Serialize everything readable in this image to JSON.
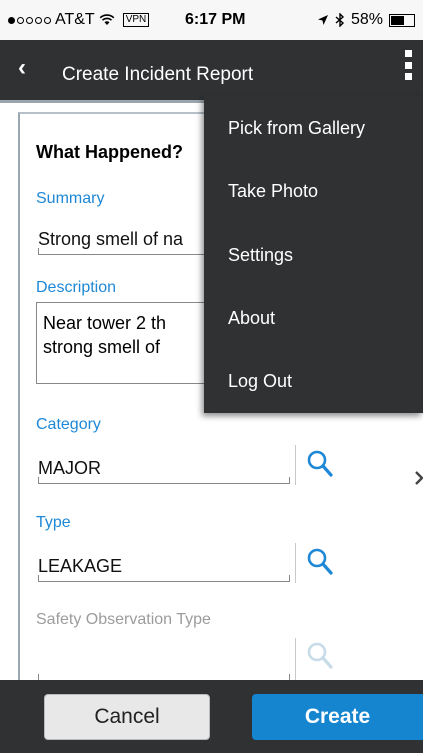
{
  "status": {
    "carrier": "AT&T",
    "vpn": "VPN",
    "time": "6:17 PM",
    "battery": "58%",
    "battery_level": 0.58
  },
  "appbar": {
    "back_glyph": "‹",
    "title": "Create Incident Report"
  },
  "form": {
    "heading": "What Happened?",
    "summary_label": "Summary",
    "summary_value": "Strong smell of na",
    "description_label": "Description",
    "description_value": "Near tower 2 th strong smell of",
    "category_label": "Category",
    "category_value": "MAJOR",
    "type_label": "Type",
    "type_value": "LEAKAGE",
    "safety_label": "Safety Observation Type",
    "safety_value": ""
  },
  "menu": {
    "items": [
      "Pick from Gallery",
      "Take Photo",
      "Settings",
      "About",
      "Log Out"
    ]
  },
  "buttons": {
    "cancel": "Cancel",
    "create": "Create"
  },
  "colors": {
    "accent": "#1e88d6",
    "bar": "#2f3133",
    "create": "#1585cf"
  }
}
